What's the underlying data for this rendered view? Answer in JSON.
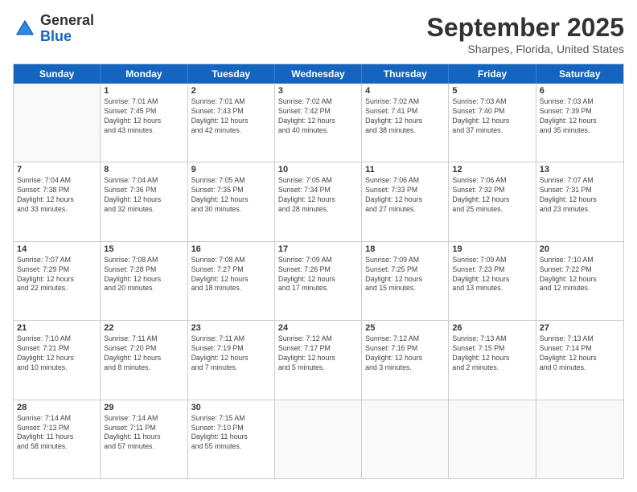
{
  "logo": {
    "line1": "General",
    "line2": "Blue"
  },
  "title": "September 2025",
  "location": "Sharpes, Florida, United States",
  "days_of_week": [
    "Sunday",
    "Monday",
    "Tuesday",
    "Wednesday",
    "Thursday",
    "Friday",
    "Saturday"
  ],
  "weeks": [
    [
      {
        "day": "",
        "info": ""
      },
      {
        "day": "1",
        "info": "Sunrise: 7:01 AM\nSunset: 7:45 PM\nDaylight: 12 hours\nand 43 minutes."
      },
      {
        "day": "2",
        "info": "Sunrise: 7:01 AM\nSunset: 7:43 PM\nDaylight: 12 hours\nand 42 minutes."
      },
      {
        "day": "3",
        "info": "Sunrise: 7:02 AM\nSunset: 7:42 PM\nDaylight: 12 hours\nand 40 minutes."
      },
      {
        "day": "4",
        "info": "Sunrise: 7:02 AM\nSunset: 7:41 PM\nDaylight: 12 hours\nand 38 minutes."
      },
      {
        "day": "5",
        "info": "Sunrise: 7:03 AM\nSunset: 7:40 PM\nDaylight: 12 hours\nand 37 minutes."
      },
      {
        "day": "6",
        "info": "Sunrise: 7:03 AM\nSunset: 7:39 PM\nDaylight: 12 hours\nand 35 minutes."
      }
    ],
    [
      {
        "day": "7",
        "info": "Sunrise: 7:04 AM\nSunset: 7:38 PM\nDaylight: 12 hours\nand 33 minutes."
      },
      {
        "day": "8",
        "info": "Sunrise: 7:04 AM\nSunset: 7:36 PM\nDaylight: 12 hours\nand 32 minutes."
      },
      {
        "day": "9",
        "info": "Sunrise: 7:05 AM\nSunset: 7:35 PM\nDaylight: 12 hours\nand 30 minutes."
      },
      {
        "day": "10",
        "info": "Sunrise: 7:05 AM\nSunset: 7:34 PM\nDaylight: 12 hours\nand 28 minutes."
      },
      {
        "day": "11",
        "info": "Sunrise: 7:06 AM\nSunset: 7:33 PM\nDaylight: 12 hours\nand 27 minutes."
      },
      {
        "day": "12",
        "info": "Sunrise: 7:06 AM\nSunset: 7:32 PM\nDaylight: 12 hours\nand 25 minutes."
      },
      {
        "day": "13",
        "info": "Sunrise: 7:07 AM\nSunset: 7:31 PM\nDaylight: 12 hours\nand 23 minutes."
      }
    ],
    [
      {
        "day": "14",
        "info": "Sunrise: 7:07 AM\nSunset: 7:29 PM\nDaylight: 12 hours\nand 22 minutes."
      },
      {
        "day": "15",
        "info": "Sunrise: 7:08 AM\nSunset: 7:28 PM\nDaylight: 12 hours\nand 20 minutes."
      },
      {
        "day": "16",
        "info": "Sunrise: 7:08 AM\nSunset: 7:27 PM\nDaylight: 12 hours\nand 18 minutes."
      },
      {
        "day": "17",
        "info": "Sunrise: 7:09 AM\nSunset: 7:26 PM\nDaylight: 12 hours\nand 17 minutes."
      },
      {
        "day": "18",
        "info": "Sunrise: 7:09 AM\nSunset: 7:25 PM\nDaylight: 12 hours\nand 15 minutes."
      },
      {
        "day": "19",
        "info": "Sunrise: 7:09 AM\nSunset: 7:23 PM\nDaylight: 12 hours\nand 13 minutes."
      },
      {
        "day": "20",
        "info": "Sunrise: 7:10 AM\nSunset: 7:22 PM\nDaylight: 12 hours\nand 12 minutes."
      }
    ],
    [
      {
        "day": "21",
        "info": "Sunrise: 7:10 AM\nSunset: 7:21 PM\nDaylight: 12 hours\nand 10 minutes."
      },
      {
        "day": "22",
        "info": "Sunrise: 7:11 AM\nSunset: 7:20 PM\nDaylight: 12 hours\nand 8 minutes."
      },
      {
        "day": "23",
        "info": "Sunrise: 7:11 AM\nSunset: 7:19 PM\nDaylight: 12 hours\nand 7 minutes."
      },
      {
        "day": "24",
        "info": "Sunrise: 7:12 AM\nSunset: 7:17 PM\nDaylight: 12 hours\nand 5 minutes."
      },
      {
        "day": "25",
        "info": "Sunrise: 7:12 AM\nSunset: 7:16 PM\nDaylight: 12 hours\nand 3 minutes."
      },
      {
        "day": "26",
        "info": "Sunrise: 7:13 AM\nSunset: 7:15 PM\nDaylight: 12 hours\nand 2 minutes."
      },
      {
        "day": "27",
        "info": "Sunrise: 7:13 AM\nSunset: 7:14 PM\nDaylight: 12 hours\nand 0 minutes."
      }
    ],
    [
      {
        "day": "28",
        "info": "Sunrise: 7:14 AM\nSunset: 7:13 PM\nDaylight: 11 hours\nand 58 minutes."
      },
      {
        "day": "29",
        "info": "Sunrise: 7:14 AM\nSunset: 7:11 PM\nDaylight: 11 hours\nand 57 minutes."
      },
      {
        "day": "30",
        "info": "Sunrise: 7:15 AM\nSunset: 7:10 PM\nDaylight: 11 hours\nand 55 minutes."
      },
      {
        "day": "",
        "info": ""
      },
      {
        "day": "",
        "info": ""
      },
      {
        "day": "",
        "info": ""
      },
      {
        "day": "",
        "info": ""
      }
    ]
  ]
}
